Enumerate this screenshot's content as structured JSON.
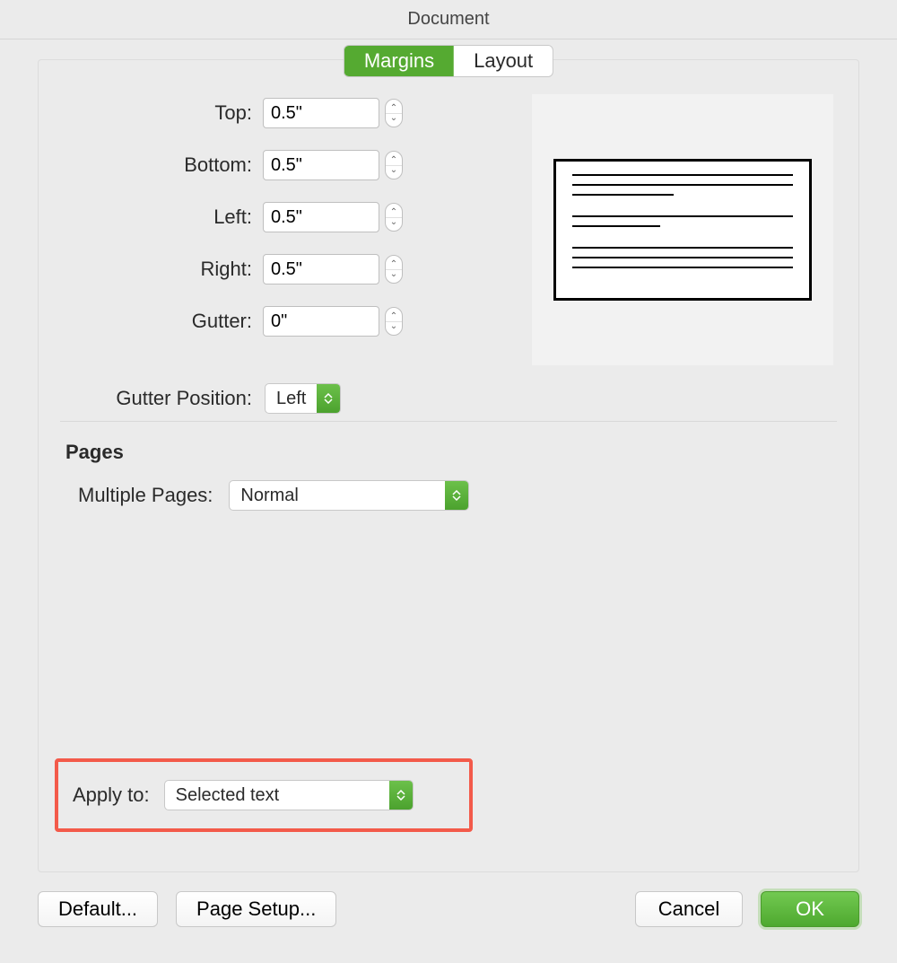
{
  "window": {
    "title": "Document"
  },
  "tabs": {
    "margins": "Margins",
    "layout": "Layout",
    "active": "margins"
  },
  "margins": {
    "top_label": "Top:",
    "top_value": "0.5\"",
    "bottom_label": "Bottom:",
    "bottom_value": "0.5\"",
    "left_label": "Left:",
    "left_value": "0.5\"",
    "right_label": "Right:",
    "right_value": "0.5\"",
    "gutter_label": "Gutter:",
    "gutter_value": "0\"",
    "gutter_pos_label": "Gutter Position:",
    "gutter_pos_value": "Left"
  },
  "pages": {
    "heading": "Pages",
    "multiple_label": "Multiple Pages:",
    "multiple_value": "Normal"
  },
  "apply": {
    "label": "Apply to:",
    "value": "Selected text"
  },
  "buttons": {
    "default": "Default...",
    "page_setup": "Page Setup...",
    "cancel": "Cancel",
    "ok": "OK"
  }
}
